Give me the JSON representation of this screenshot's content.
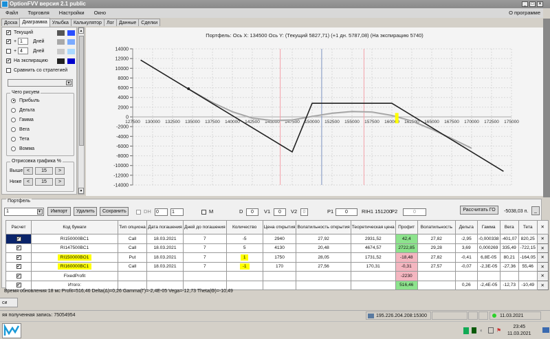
{
  "window": {
    "title": "OptionFVV версия 2.1 public"
  },
  "menu": [
    "Файл",
    "Торговля",
    "Настройки",
    "Окно"
  ],
  "about": "О программе",
  "tabs": [
    "Доска",
    "Диаграмма",
    "Улыбка",
    "Калькулятор",
    "Лог",
    "Данные",
    "Сделки"
  ],
  "left": {
    "rows": [
      {
        "label": "Текущий",
        "checked": true,
        "colors": [
          "#555555",
          "#2a4fff"
        ]
      },
      {
        "plus": "+",
        "days": "1",
        "unit": "Дней",
        "checked": true,
        "colors": [
          "#a8a8a8",
          "#7aaaff"
        ]
      },
      {
        "plus": "+",
        "days": "4",
        "unit": "Дней",
        "checked": false,
        "colors": [
          "#c8c8c8",
          "#a8d8ff"
        ]
      },
      {
        "label": "На экспирацию",
        "checked": true,
        "colors": [
          "#222222",
          "#0000cc"
        ]
      }
    ],
    "compare": "Сравнить со стратегией",
    "draw_group": "Чего рисуем",
    "options": [
      "Прибыль",
      "Дельта",
      "Гамма",
      "Вега",
      "Тета",
      "Вомма"
    ],
    "selected": 0,
    "range_group": "Отрисовка графика %",
    "above": {
      "label": "Выше",
      "value": "15"
    },
    "below": {
      "label": "Ниже",
      "value": "15"
    },
    "left_arrow": "<",
    "right_arrow": ">"
  },
  "chart_data": {
    "type": "line",
    "title": "Портфель: Ось X: 134500 Ось Y:  (Текущий 5827,71)  (+1 дн. 5787,08)  (На экспирацию 5740)",
    "xlim": [
      127500,
      175000
    ],
    "ylim": [
      -14000,
      14000
    ],
    "xticks": [
      "127500",
      "130000",
      "132500",
      "135000",
      "137500",
      "140000",
      "142500",
      "145000",
      "147500",
      "150000",
      "152500",
      "155000",
      "157500",
      "160000",
      "162500",
      "165000",
      "167500",
      "170000",
      "172500",
      "175000"
    ],
    "yticks": [
      "14000",
      "12000",
      "10000",
      "8000",
      "6000",
      "4000",
      "2000",
      "0",
      "-2000",
      "-4000",
      "-6000",
      "-8000",
      "-10000",
      "-12000",
      "-14000"
    ],
    "vlines": [
      {
        "x": 151200,
        "color": "#7a90c0"
      },
      {
        "x": 146000,
        "color": "#f4a0a8"
      },
      {
        "x": 156500,
        "color": "#f4a0a8"
      }
    ],
    "marker": {
      "x": 134500,
      "y": 5800
    },
    "series": [
      {
        "name": "На экспирацию",
        "color": "#222222",
        "x": [
          128500,
          147500,
          150000,
          160000,
          174000
        ],
        "y": [
          11700,
          -7200,
          2800,
          2800,
          -11200
        ]
      },
      {
        "name": "Текущий",
        "color": "#999999",
        "x": [
          134500,
          137500,
          140000,
          142500,
          145000,
          147500,
          150000,
          152500,
          155000,
          157500,
          160000,
          162500,
          165000,
          167500,
          170000
        ],
        "y": [
          5800,
          3000,
          1100,
          -200,
          -700,
          -600,
          150,
          800,
          1150,
          1050,
          350,
          -800,
          -2500,
          -4400,
          -6400
        ]
      },
      {
        "name": "+1 дн.",
        "color": "#c0c0c0",
        "x": [
          134500,
          137500,
          140000,
          142500,
          145000,
          147500,
          150000,
          152500,
          155000,
          157500,
          160000,
          162500,
          165000,
          167500,
          170000
        ],
        "y": [
          5780,
          2900,
          950,
          -350,
          -850,
          -750,
          0,
          650,
          1000,
          900,
          200,
          -950,
          -2650,
          -4550,
          -6550
        ]
      }
    ]
  },
  "portfolio": {
    "group": "Портфель",
    "select": "1",
    "import": "Импорт",
    "delete": "Удалить",
    "save": "Сохранить",
    "dh": "DH",
    "dh1": "0",
    "dh2": "1",
    "m": "M",
    "d_label": "D",
    "d": "0",
    "v1_label": "V1",
    "v1": "0",
    "v2_label": "V2",
    "v2": "0",
    "p1_label": "P1",
    "p1": "0",
    "instrument": "RIH1 151200",
    "p2_label": "P2",
    "p2": "0",
    "calc_go": "Рассчитать ГО",
    "go_value": "-5038,03 п.",
    "minimize": "_",
    "headers": [
      "Расчет",
      "Код бумаги",
      "Тип опциона",
      "Дата погашения",
      "Дней до погашения",
      "Количество",
      "Цена открытия",
      "Волатильность открытия",
      "Теоретическая цена",
      "Профит",
      "Волатильность",
      "Дельта",
      "Гамма",
      "Вега",
      "Тета",
      "✕"
    ],
    "rows": [
      [
        "RI150000BC1",
        "Call",
        "18.03.2021",
        "7",
        "-5",
        "2940",
        "27,92",
        "2931,52",
        "42,4",
        "27,82",
        "-2,95",
        "-0,000338",
        "-401,07",
        "820,25"
      ],
      [
        "RI147500BC1",
        "Call",
        "18.03.2021",
        "7",
        "5",
        "4130",
        "20,48",
        "4674,57",
        "2722,85",
        "29,28",
        "3,69",
        "0,000269",
        "335,49",
        "-722,15"
      ],
      [
        "RI150000BO1",
        "Put",
        "18.03.2021",
        "7",
        "1",
        "1750",
        "28,05",
        "1731,52",
        "-18,48",
        "27,82",
        "-0,41",
        "6,8E-05",
        "80,21",
        "-164,05"
      ],
      [
        "RI160000BC1",
        "Call",
        "18.03.2021",
        "7",
        "-1",
        "170",
        "27,56",
        "170,31",
        "-0,31",
        "27,57",
        "-0,07",
        "-2,3E-05",
        "-27,36",
        "55,46"
      ],
      [
        "FixedProfit",
        "",
        "",
        "",
        "",
        "",
        "",
        "",
        "-2230",
        "",
        "",
        "",
        "",
        ""
      ],
      [
        "Итого:",
        "",
        "",
        "",
        "",
        "",
        "",
        "",
        "516,46",
        "",
        "0,26",
        "-2,4E-05",
        "-12,73",
        "-10,49"
      ]
    ],
    "profit_sign": [
      "pos",
      "pos",
      "neg",
      "neg",
      "neg",
      "pos"
    ],
    "highlighted_rows": [
      2,
      3
    ]
  },
  "status": "Время обновления 18 мс  Profit=516,46 Delta(Δ)=0,26 Gamma(Γ)=-2,4E-05 Vega=-12,73 Theta(Θ)=-10,49",
  "bottom_tab": "си",
  "statusbar": {
    "last_record": "яя полученная запись: 75054954",
    "server": "195.226.204.208:15300",
    "date": "11.03.2021"
  },
  "taskbar": {
    "time": "23:45",
    "date": "11.03.2021"
  }
}
